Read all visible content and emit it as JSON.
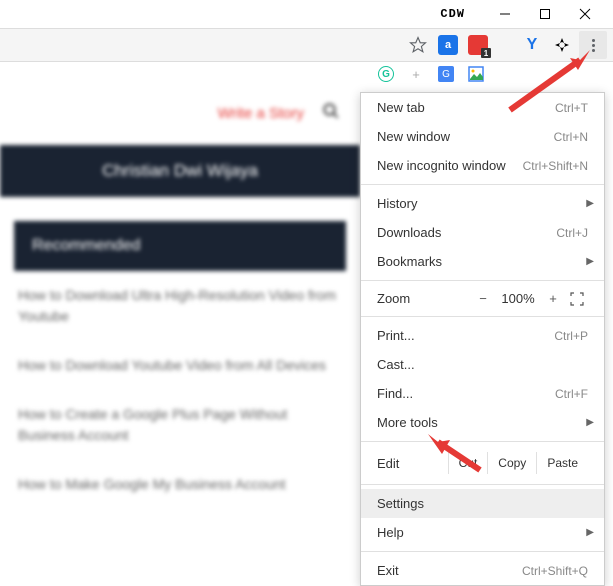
{
  "titlebar": {
    "app_name": "CDW"
  },
  "toolbar": {
    "ext_a_label": "a",
    "ext_y_label": "Y",
    "ext_dark_glyph": "✦"
  },
  "icon_row": {
    "grammarly": "G",
    "plus": "+",
    "translate": "G",
    "image": "◧"
  },
  "page": {
    "write_story": "Write a Story",
    "author": "Christian Dwi Wijaya",
    "sidebar_header": "Recommended",
    "sidebar_items": [
      "How to Download Ultra High-Resolution Video from Youtube",
      "How to Download Youtube Video from All Devices",
      "How to Create a Google Plus Page Without Business Account",
      "How to Make Google My Business Account"
    ]
  },
  "menu": {
    "new_tab": {
      "label": "New tab",
      "shortcut": "Ctrl+T"
    },
    "new_window": {
      "label": "New window",
      "shortcut": "Ctrl+N"
    },
    "new_incognito": {
      "label": "New incognito window",
      "shortcut": "Ctrl+Shift+N"
    },
    "history": {
      "label": "History"
    },
    "downloads": {
      "label": "Downloads",
      "shortcut": "Ctrl+J"
    },
    "bookmarks": {
      "label": "Bookmarks"
    },
    "zoom": {
      "label": "Zoom",
      "value": "100%",
      "minus": "−",
      "plus": "+"
    },
    "print": {
      "label": "Print...",
      "shortcut": "Ctrl+P"
    },
    "cast": {
      "label": "Cast..."
    },
    "find": {
      "label": "Find...",
      "shortcut": "Ctrl+F"
    },
    "more_tools": {
      "label": "More tools"
    },
    "edit": {
      "label": "Edit",
      "cut": "Cut",
      "copy": "Copy",
      "paste": "Paste"
    },
    "settings": {
      "label": "Settings"
    },
    "help": {
      "label": "Help"
    },
    "exit": {
      "label": "Exit",
      "shortcut": "Ctrl+Shift+Q"
    }
  }
}
